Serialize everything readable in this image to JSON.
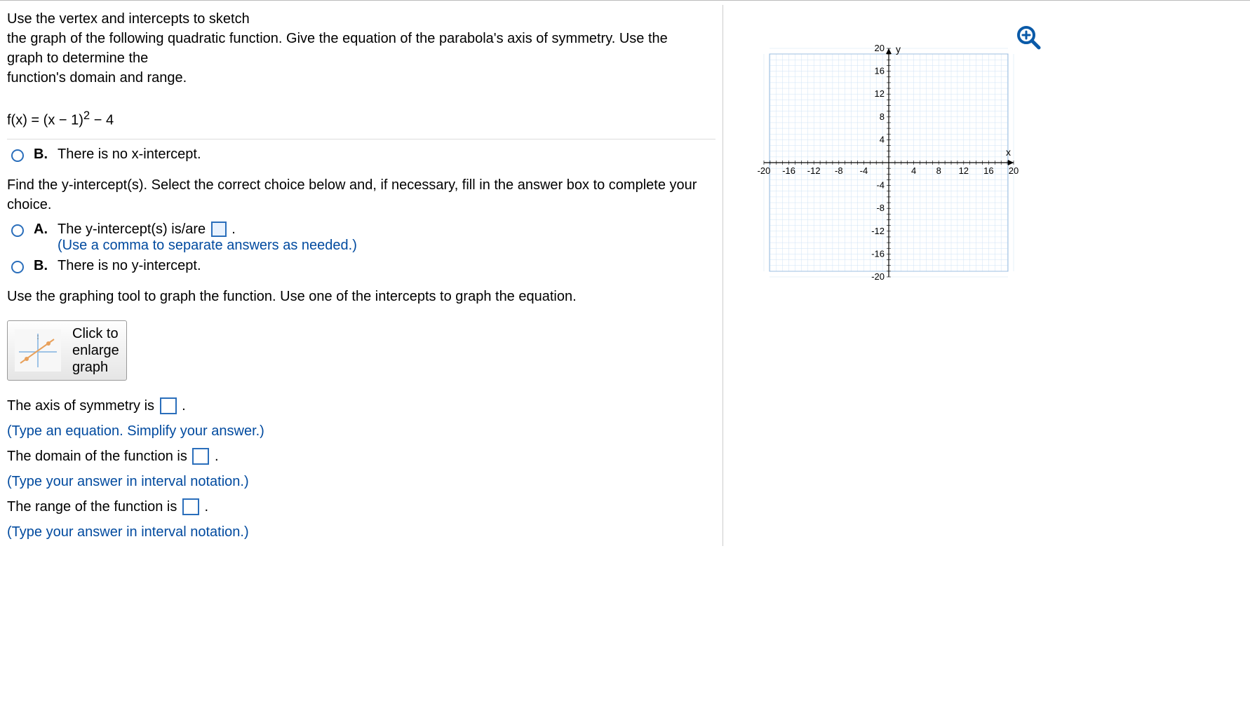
{
  "question": {
    "line1": "Use the vertex and intercepts to sketch",
    "line2": "the graph of the following quadratic function. Give the equation of the parabola's axis of symmetry. Use the",
    "line3": "graph to determine the",
    "line4": "function's domain and range.",
    "fx_prefix": "f(x) = (x − 1)",
    "fx_exp": "2",
    "fx_suffix": " − 4"
  },
  "x_option_B": {
    "label": "B.",
    "text": "There is no x-intercept."
  },
  "y_prompt": "Find the y-intercept(s). Select the correct choice below and, if necessary, fill in the answer box to complete your choice.",
  "y_option_A": {
    "label": "A.",
    "text_before": "The y-intercept(s) is/are ",
    "text_after": ".",
    "hint": "(Use a comma to separate answers as needed.)"
  },
  "y_option_B": {
    "label": "B.",
    "text": "There is no y-intercept."
  },
  "graph_prompt": "Use the graphing tool to graph the function. Use one of the intercepts to graph the equation.",
  "graph_button": {
    "line1": "Click to",
    "line2": "enlarge",
    "line3": "graph"
  },
  "axis_line": {
    "before": "The axis of symmetry is ",
    "after": "."
  },
  "axis_hint": "(Type an equation.  Simplify your answer.)",
  "domain_line": {
    "before": "The domain of the function is ",
    "after": "."
  },
  "domain_hint": "(Type your answer in interval notation.)",
  "range_line": {
    "before": "The range of the function is ",
    "after": "."
  },
  "range_hint": "(Type your answer in interval notation.)",
  "plane": {
    "x_label": "x",
    "y_label": "y",
    "y_ticks_pos": [
      "20",
      "16",
      "12",
      "8",
      "4"
    ],
    "y_ticks_neg": [
      "-4",
      "-8",
      "-12",
      "-16",
      "-20"
    ],
    "x_ticks_neg": [
      "-20",
      "-16",
      "-12",
      "-8",
      "-4"
    ],
    "x_ticks_pos": [
      "4",
      "8",
      "12",
      "16",
      "20"
    ]
  },
  "chart_data": {
    "type": "scatter",
    "title": "",
    "xlabel": "x",
    "ylabel": "y",
    "xlim": [
      -20,
      20
    ],
    "ylim": [
      -20,
      20
    ],
    "x_ticks": [
      -20,
      -16,
      -12,
      -8,
      -4,
      4,
      8,
      12,
      16,
      20
    ],
    "y_ticks": [
      -20,
      -16,
      -12,
      -8,
      -4,
      4,
      8,
      12,
      16,
      20
    ],
    "series": []
  }
}
